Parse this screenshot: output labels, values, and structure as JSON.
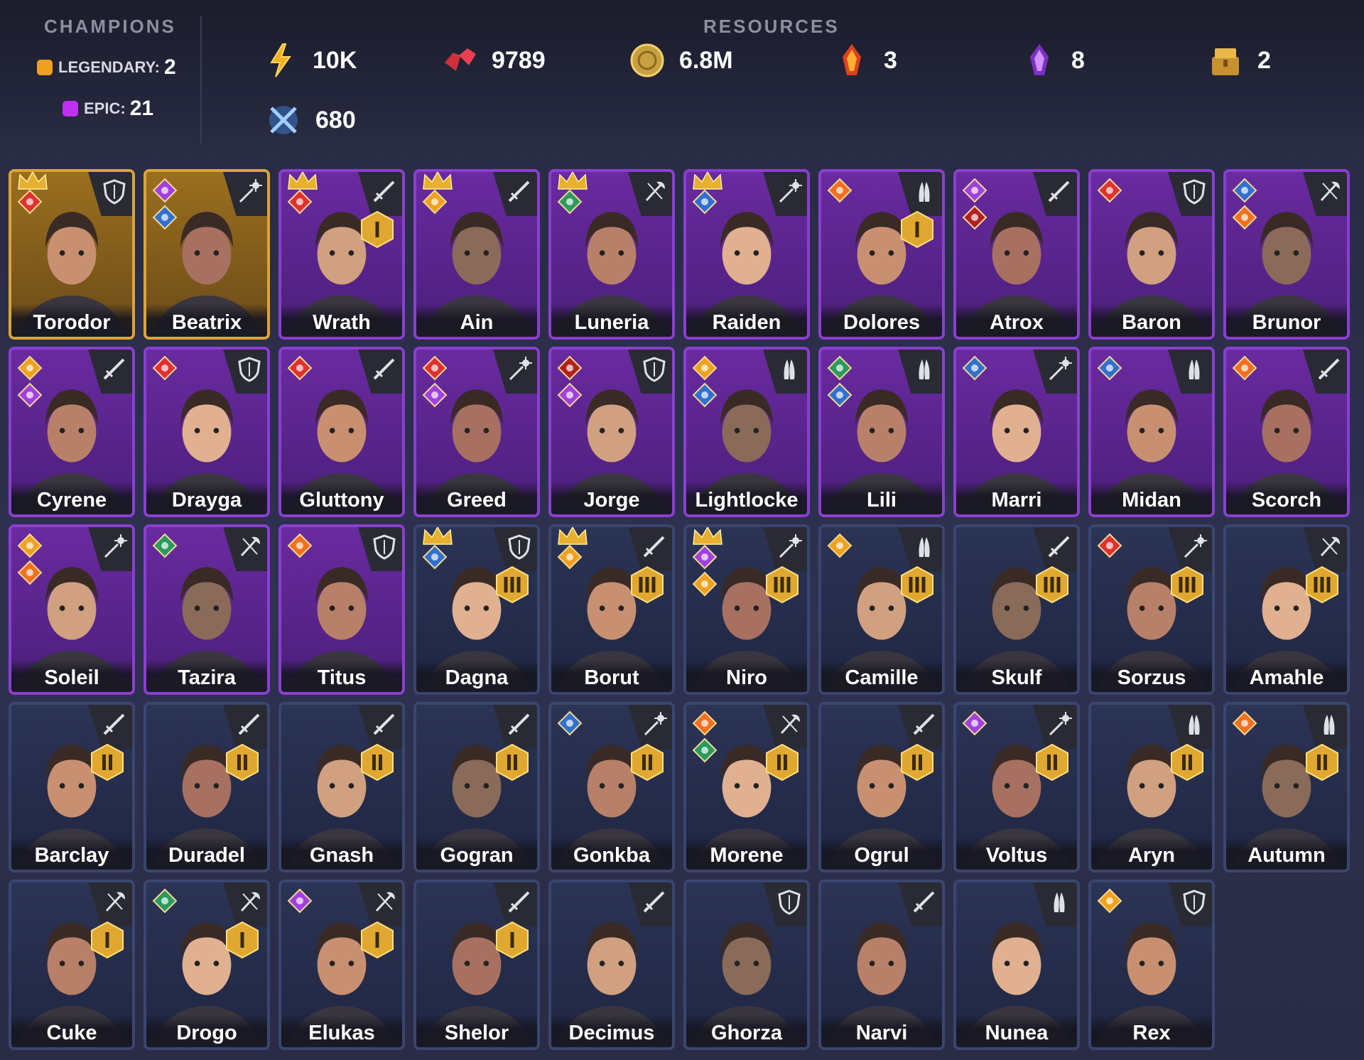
{
  "header": {
    "champions_title": "CHAMPIONS",
    "resources_title": "RESOURCES",
    "legendary": {
      "label": "LEGENDARY:",
      "count": "2",
      "color": "#f0a020"
    },
    "epic": {
      "label": "EPIC:",
      "count": "21",
      "color": "#c030f0"
    },
    "resources": [
      {
        "icon": "energy-icon",
        "value": "10K"
      },
      {
        "icon": "rubies-icon",
        "value": "9789"
      },
      {
        "icon": "coin-icon",
        "value": "6.8M"
      },
      {
        "icon": "fire-crystal-icon",
        "value": "3"
      },
      {
        "icon": "void-crystal-icon",
        "value": "8"
      },
      {
        "icon": "gold-chest-icon",
        "value": "2"
      },
      {
        "icon": "arena-token-icon",
        "value": "680"
      }
    ]
  },
  "colors": {
    "legendary_border": "#d8a53a",
    "epic_border": "#8a3fd0",
    "rare_border": "#3a4670"
  },
  "champions": [
    {
      "name": "Torodor",
      "rarity": "legendary",
      "class": "shield",
      "crown": true,
      "affinities": [
        "fire"
      ]
    },
    {
      "name": "Beatrix",
      "rarity": "legendary",
      "class": "magic",
      "crown": false,
      "affinities": [
        "void",
        "water"
      ]
    },
    {
      "name": "Wrath",
      "rarity": "epic",
      "class": "sword",
      "crown": true,
      "rank": "I",
      "affinities": [
        "fire"
      ]
    },
    {
      "name": "Ain",
      "rarity": "epic",
      "class": "sword",
      "crown": true,
      "affinities": [
        "light"
      ]
    },
    {
      "name": "Luneria",
      "rarity": "epic",
      "class": "axe",
      "crown": true,
      "affinities": [
        "nature"
      ]
    },
    {
      "name": "Raiden",
      "rarity": "epic",
      "class": "magic",
      "crown": true,
      "affinities": [
        "water"
      ]
    },
    {
      "name": "Dolores",
      "rarity": "epic",
      "class": "support",
      "crown": false,
      "rank": "I",
      "affinities": [
        "ember"
      ]
    },
    {
      "name": "Atrox",
      "rarity": "epic",
      "class": "sword",
      "crown": false,
      "affinities": [
        "void",
        "chaos"
      ]
    },
    {
      "name": "Baron",
      "rarity": "epic",
      "class": "shield",
      "crown": false,
      "affinities": [
        "fire"
      ]
    },
    {
      "name": "Brunor",
      "rarity": "epic",
      "class": "axe",
      "crown": false,
      "affinities": [
        "water",
        "ember"
      ]
    },
    {
      "name": "Cyrene",
      "rarity": "epic",
      "class": "sword",
      "crown": false,
      "affinities": [
        "light",
        "void"
      ]
    },
    {
      "name": "Drayga",
      "rarity": "epic",
      "class": "shield",
      "crown": false,
      "affinities": [
        "fire"
      ]
    },
    {
      "name": "Gluttony",
      "rarity": "epic",
      "class": "sword",
      "crown": false,
      "affinities": [
        "fire"
      ]
    },
    {
      "name": "Greed",
      "rarity": "epic",
      "class": "magic",
      "crown": false,
      "affinities": [
        "fire",
        "void"
      ]
    },
    {
      "name": "Jorge",
      "rarity": "epic",
      "class": "shield",
      "crown": false,
      "affinities": [
        "chaos",
        "void"
      ]
    },
    {
      "name": "Lightlocke",
      "rarity": "epic",
      "class": "support",
      "crown": false,
      "affinities": [
        "light",
        "water"
      ]
    },
    {
      "name": "Lili",
      "rarity": "epic",
      "class": "support",
      "crown": false,
      "affinities": [
        "nature",
        "water"
      ]
    },
    {
      "name": "Marri",
      "rarity": "epic",
      "class": "magic",
      "crown": false,
      "affinities": [
        "water"
      ]
    },
    {
      "name": "Midan",
      "rarity": "epic",
      "class": "support",
      "crown": false,
      "affinities": [
        "water"
      ]
    },
    {
      "name": "Scorch",
      "rarity": "epic",
      "class": "sword",
      "crown": false,
      "affinities": [
        "ember"
      ]
    },
    {
      "name": "Soleil",
      "rarity": "epic",
      "class": "magic",
      "crown": false,
      "affinities": [
        "light",
        "ember"
      ]
    },
    {
      "name": "Tazira",
      "rarity": "epic",
      "class": "axe",
      "crown": false,
      "affinities": [
        "nature"
      ]
    },
    {
      "name": "Titus",
      "rarity": "epic",
      "class": "shield",
      "crown": false,
      "affinities": [
        "ember"
      ]
    },
    {
      "name": "Dagna",
      "rarity": "rare",
      "class": "shield",
      "crown": true,
      "rank": "III",
      "affinities": [
        "water"
      ]
    },
    {
      "name": "Borut",
      "rarity": "rare",
      "class": "sword",
      "crown": true,
      "rank": "III",
      "affinities": [
        "light"
      ]
    },
    {
      "name": "Niro",
      "rarity": "rare",
      "class": "magic",
      "crown": true,
      "rank": "III",
      "affinities": [
        "void",
        "light"
      ]
    },
    {
      "name": "Camille",
      "rarity": "rare",
      "class": "support",
      "crown": false,
      "rank": "III",
      "affinities": [
        "light"
      ]
    },
    {
      "name": "Skulf",
      "rarity": "rare",
      "class": "sword",
      "crown": false,
      "rank": "III",
      "affinities": []
    },
    {
      "name": "Sorzus",
      "rarity": "rare",
      "class": "magic",
      "crown": false,
      "rank": "III",
      "affinities": [
        "fire"
      ]
    },
    {
      "name": "Amahle",
      "rarity": "rare",
      "class": "axe",
      "crown": false,
      "rank": "III",
      "affinities": []
    },
    {
      "name": "Barclay",
      "rarity": "rare",
      "class": "sword",
      "crown": false,
      "rank": "II",
      "affinities": []
    },
    {
      "name": "Duradel",
      "rarity": "rare",
      "class": "sword",
      "crown": false,
      "rank": "II",
      "affinities": []
    },
    {
      "name": "Gnash",
      "rarity": "rare",
      "class": "sword",
      "crown": false,
      "rank": "II",
      "affinities": []
    },
    {
      "name": "Gogran",
      "rarity": "rare",
      "class": "sword",
      "crown": false,
      "rank": "II",
      "affinities": []
    },
    {
      "name": "Gonkba",
      "rarity": "rare",
      "class": "magic",
      "crown": false,
      "rank": "II",
      "affinities": [
        "water"
      ]
    },
    {
      "name": "Morene",
      "rarity": "rare",
      "class": "axe",
      "crown": false,
      "rank": "II",
      "affinities": [
        "ember",
        "nature"
      ]
    },
    {
      "name": "Ogrul",
      "rarity": "rare",
      "class": "sword",
      "crown": false,
      "rank": "II",
      "affinities": []
    },
    {
      "name": "Voltus",
      "rarity": "rare",
      "class": "magic",
      "crown": false,
      "rank": "II",
      "affinities": [
        "void"
      ]
    },
    {
      "name": "Aryn",
      "rarity": "rare",
      "class": "support",
      "crown": false,
      "rank": "II",
      "affinities": []
    },
    {
      "name": "Autumn",
      "rarity": "rare",
      "class": "support",
      "crown": false,
      "rank": "II",
      "affinities": [
        "ember"
      ]
    },
    {
      "name": "Cuke",
      "rarity": "rare",
      "class": "axe",
      "crown": false,
      "rank": "I",
      "affinities": []
    },
    {
      "name": "Drogo",
      "rarity": "rare",
      "class": "axe",
      "crown": false,
      "rank": "I",
      "affinities": [
        "nature"
      ]
    },
    {
      "name": "Elukas",
      "rarity": "rare",
      "class": "axe",
      "crown": false,
      "rank": "I",
      "affinities": [
        "void"
      ]
    },
    {
      "name": "Shelor",
      "rarity": "rare",
      "class": "sword",
      "crown": false,
      "rank": "I",
      "affinities": []
    },
    {
      "name": "Decimus",
      "rarity": "rare",
      "class": "sword",
      "crown": false,
      "affinities": []
    },
    {
      "name": "Ghorza",
      "rarity": "rare",
      "class": "shield",
      "crown": false,
      "affinities": []
    },
    {
      "name": "Narvi",
      "rarity": "rare",
      "class": "sword",
      "crown": false,
      "affinities": []
    },
    {
      "name": "Nunea",
      "rarity": "rare",
      "class": "support",
      "crown": false,
      "affinities": []
    },
    {
      "name": "Rex",
      "rarity": "rare",
      "class": "shield",
      "crown": false,
      "affinities": [
        "light"
      ]
    }
  ]
}
